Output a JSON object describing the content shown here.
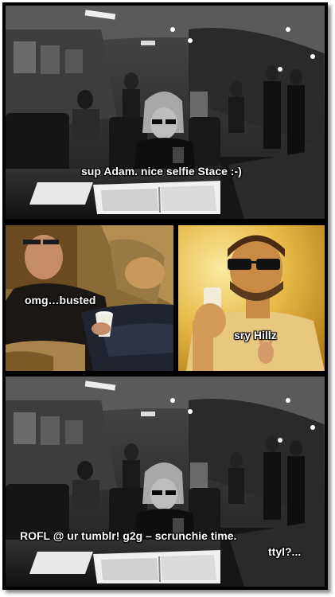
{
  "panels": {
    "top": {
      "caption": "sup  Adam.  nice selfie Stace :-)"
    },
    "middle_left": {
      "caption": "omg…busted"
    },
    "middle_right": {
      "caption": "sry Hillz"
    },
    "bottom": {
      "caption_line1": "ROFL @ ur tumblr!  g2g – scrunchie time.",
      "caption_line2": "ttyl?..."
    }
  },
  "colors": {
    "frame": "#000000",
    "caption_text": "#ffffff",
    "left_panel_tone": "#a57a3a",
    "right_panel_tone": "#e3b43f"
  }
}
